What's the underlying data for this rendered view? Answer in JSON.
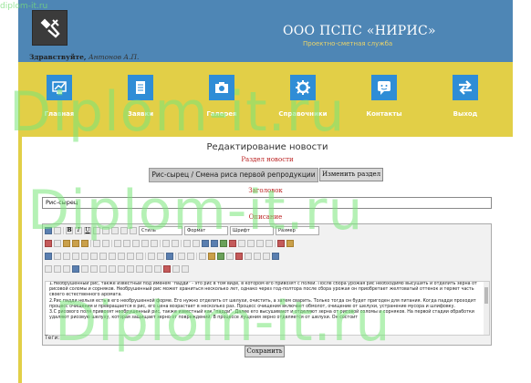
{
  "header": {
    "title": "ООО ПСПС «НИРИС»",
    "subtitle": "Проектно-сметная служба"
  },
  "user": {
    "greeting": "Здравствуйте,",
    "name": "Антонов А.П."
  },
  "nav": [
    {
      "label": "Главная",
      "icon": "chart-icon"
    },
    {
      "label": "Заявки",
      "icon": "document-icon"
    },
    {
      "label": "Галерея",
      "icon": "camera-icon"
    },
    {
      "label": "Справочники",
      "icon": "gear-icon"
    },
    {
      "label": "Контакты",
      "icon": "chat-icon"
    },
    {
      "label": "Выход",
      "icon": "exit-arrows-icon"
    }
  ],
  "form": {
    "page_title": "Редактирование новости",
    "section_label": "Раздел новости",
    "section_value": "Рис-сырец / Смена риса первой репродукции",
    "change_section_button": "Изменить раздел",
    "title_label": "Заголовок",
    "title_value": "Рис-сырец",
    "description_label": "Описание",
    "tags_label": "Теги:",
    "save_button": "Сохранить"
  },
  "toolbar": {
    "style_select": "Стиль",
    "format_select": "Формат",
    "font_select": "Шрифт",
    "size_select": "Размер",
    "bold": "B",
    "italic": "I",
    "underline": "U"
  },
  "editor": {
    "paragraphs": [
      "1.Необрушенный рис, также известный под именем \"падди\" - это рис в том виде, в котором его привозят с полей. После сбора урожая рис необходимо высушить и отделить зерна от рисовой соломы и сорняков. Необрушенный рис может храниться несколько лет, однако через год-полтора после сбора урожая он приобретает желтоватый оттенок и теряет часть своего естественного аромата.",
      "2.Рис падди нельзя есть в его необрушенной форме. Его нужно отделить от шелухи, очистить, а затем сварить. Только тогда он будет пригоден для питания. Когда падди проходит процесс очищения и превращается в рис, его цена возрастает в несколько раз. Процесс очищения включает обмолот, очищение от шелухи, устранение мусора и шлифовку.",
      "3.С рисового поля привозят необрушенный рис, также известный как \"падди\". Далее его высушивают и отделяют зерна от рисовой соломы и сорняков. На первой стадии обработки удаляют рисовую шелуху, которая защищает зерно от повреждений. В процессе лущения зерно отделяется от шелухи. Он состоит"
    ]
  },
  "watermark": {
    "text": "Diplom-it.ru",
    "corner_text": "diplom-it.ru"
  },
  "colors": {
    "header_bg": "#4e86b5",
    "page_bg": "#e2cf47",
    "nav_icon_bg": "#2f8dd6",
    "watermark": "#78e678"
  }
}
